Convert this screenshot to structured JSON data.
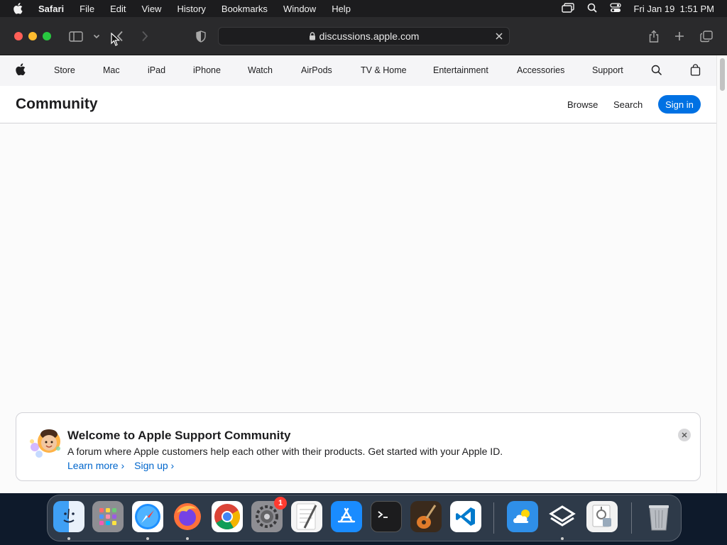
{
  "menubar": {
    "app_name": "Safari",
    "items": [
      "File",
      "Edit",
      "View",
      "History",
      "Bookmarks",
      "Window",
      "Help"
    ],
    "datetime": "Fri Jan 19  1:51 PM"
  },
  "browser": {
    "url": "discussions.apple.com"
  },
  "globalnav": {
    "items": [
      "Store",
      "Mac",
      "iPad",
      "iPhone",
      "Watch",
      "AirPods",
      "TV & Home",
      "Entertainment",
      "Accessories",
      "Support"
    ]
  },
  "community": {
    "title": "Community",
    "browse": "Browse",
    "search": "Search",
    "signin": "Sign in"
  },
  "welcome": {
    "title": "Welcome to Apple Support Community",
    "description": "A forum where Apple customers help each other with their products. Get started with your Apple ID.",
    "learn_more": "Learn more",
    "sign_up": "Sign up"
  },
  "dock": {
    "settings_badge": "1",
    "apps": [
      "finder-icon",
      "launchpad-icon",
      "safari-icon",
      "firefox-icon",
      "chrome-icon",
      "system-settings-icon",
      "textedit-icon",
      "app-store-icon",
      "terminal-icon",
      "garageband-icon",
      "vscode-icon",
      "weather-icon",
      "app-icon",
      "preview-icon",
      "trash-icon"
    ]
  },
  "colors": {
    "accent": "#0071e3",
    "link": "#0066cc"
  }
}
